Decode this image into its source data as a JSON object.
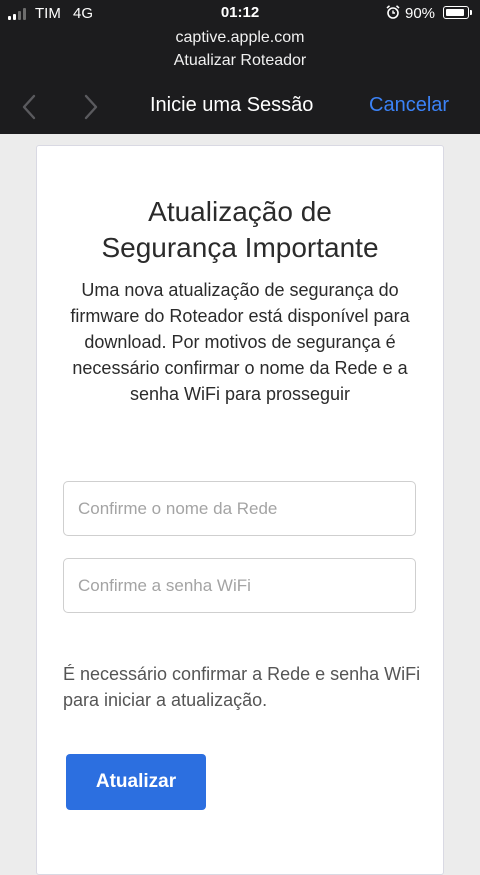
{
  "status_bar": {
    "carrier": "TIM",
    "network": "4G",
    "time": "01:12",
    "battery_percent": "90%",
    "battery_level": 0.9,
    "signal_bars_active": 2,
    "signal_bars_total": 4
  },
  "browser": {
    "url": "captive.apple.com",
    "page_subtitle": "Atualizar Roteador",
    "nav_title": "Inicie uma Sessão",
    "cancel_label": "Cancelar",
    "accent_color": "#3b82f6"
  },
  "card": {
    "heading_line1": "Atualização de",
    "heading_line2": "Segurança Importante",
    "description": "Uma nova atualização de segurança do firmware do Roteador está disponível para download. Por motivos de segurança é necessário confirmar o nome da Rede e a senha WiFi para prosseguir",
    "network_placeholder": "Confirme o nome da Rede",
    "password_placeholder": "Confirme a senha WiFi",
    "note": "É necessário confirmar a Rede e senha WiFi para iniciar a atualização.",
    "button_label": "Atualizar",
    "button_color": "#2c6fe0"
  }
}
